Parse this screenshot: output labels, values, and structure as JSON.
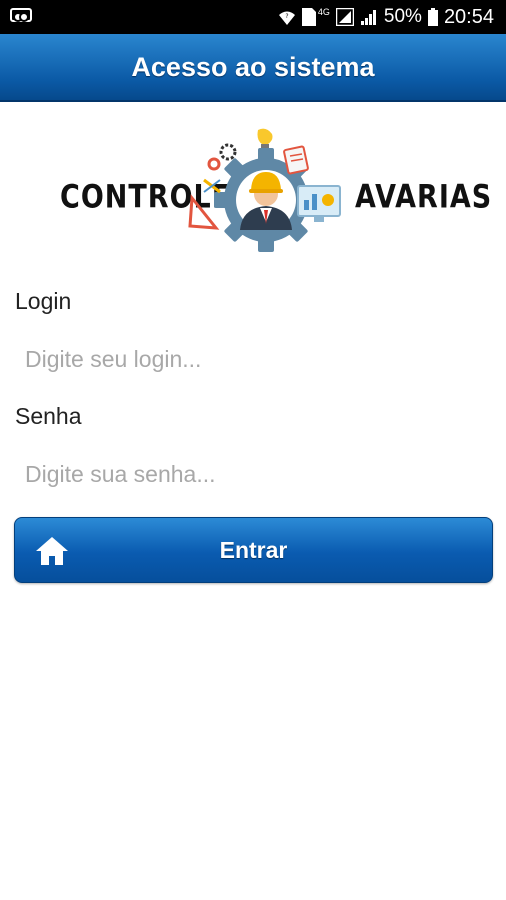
{
  "status_bar": {
    "battery_percent": "50%",
    "time": "20:54",
    "network_label": "4G",
    "sim_label": "1"
  },
  "app_bar": {
    "title": "Acesso ao sistema"
  },
  "logo": {
    "left_text": "CONTROLE",
    "right_text": "AVARIAS"
  },
  "form": {
    "login_label": "Login",
    "login_placeholder": "Digite seu login...",
    "login_value": "",
    "senha_label": "Senha",
    "senha_placeholder": "Digite sua senha...",
    "senha_value": "",
    "submit_label": "Entrar",
    "submit_icon": "home-icon"
  },
  "colors": {
    "primary": "#0b5aa6",
    "primary_light": "#2a86cf",
    "placeholder": "#a8a8a8"
  }
}
